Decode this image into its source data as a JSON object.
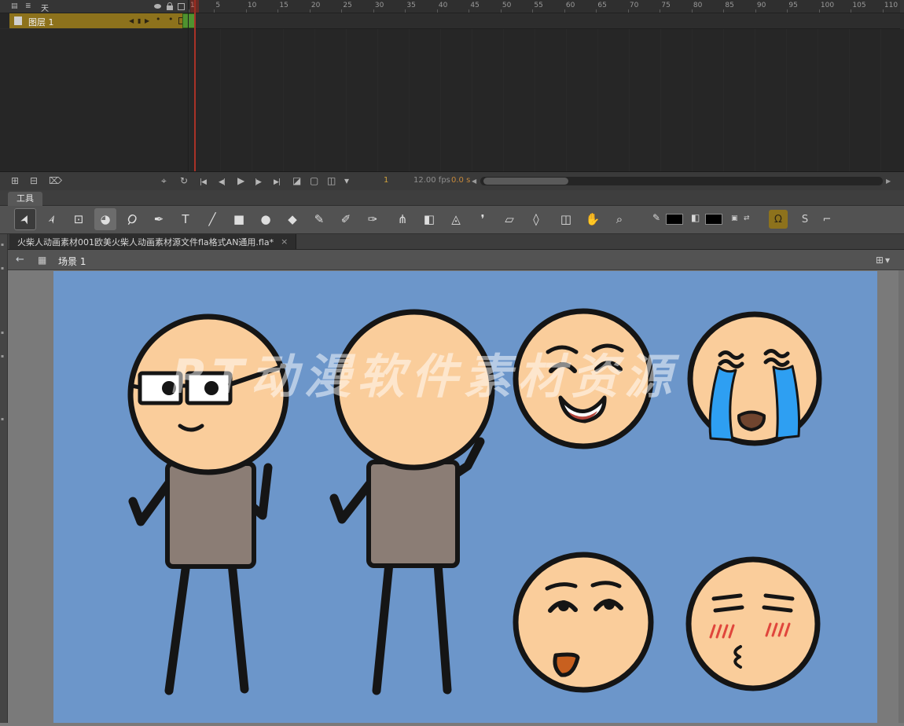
{
  "timeline": {
    "panel_label": "天",
    "header_icon_glyphs": [
      "▤",
      "≣"
    ],
    "layer": {
      "name": "图层 1",
      "nav": [
        "◀",
        "▮",
        "▶"
      ],
      "status_dots": [
        "•",
        "•"
      ]
    },
    "ruler_frames": [
      1,
      5,
      10,
      15,
      20,
      25,
      30,
      35,
      40,
      45,
      50,
      55,
      60,
      65,
      70,
      75,
      80,
      85,
      90,
      95,
      100,
      105,
      110
    ],
    "current_frame": "1",
    "frame_rate": "12.00 fps",
    "elapsed_time": "0.0 s",
    "buttons": {
      "left": [
        {
          "name": "new-layer-button",
          "glyph": "⊞"
        },
        {
          "name": "new-folder-button",
          "glyph": "⊟"
        },
        {
          "name": "delete-layer-button",
          "glyph": "⌦"
        }
      ],
      "middle": [
        {
          "name": "center-frame-button",
          "glyph": "⌖"
        },
        {
          "name": "loop-button",
          "glyph": "↻"
        }
      ],
      "playback": [
        {
          "name": "go-to-first-frame-button",
          "glyph": "|◀",
          "small": true
        },
        {
          "name": "step-back-button",
          "glyph": "◀|",
          "small": true
        },
        {
          "name": "play-button",
          "glyph": "▶"
        },
        {
          "name": "step-forward-button",
          "glyph": "|▶",
          "small": true
        },
        {
          "name": "go-to-last-frame-button",
          "glyph": "▶|",
          "small": true
        }
      ],
      "onion": [
        {
          "name": "onion-skin-button",
          "glyph": "◪"
        },
        {
          "name": "onion-skin-outlines-button",
          "glyph": "▢"
        },
        {
          "name": "edit-multiple-frames-button",
          "glyph": "◫"
        },
        {
          "name": "modify-markers-button",
          "glyph": "▾"
        }
      ],
      "scroll_left_glyph": "◀",
      "scroll_right_glyph": "▶"
    }
  },
  "tools": {
    "tab_label": "工具",
    "items": [
      {
        "name": "selection-tool",
        "glyph": "➤",
        "state": "selected",
        "rotate": -65
      },
      {
        "name": "subselection-tool",
        "glyph": "➢",
        "rotate": -65
      },
      {
        "name": "free-transform-tool",
        "glyph": "⊡"
      },
      {
        "name": "gradient-transform-tool",
        "glyph": "◕",
        "state": "highlighted"
      },
      {
        "name": "lasso-tool",
        "glyph": "Ϙ",
        "rotate": 35
      },
      {
        "name": "pen-tool",
        "glyph": "✒"
      },
      {
        "name": "text-tool",
        "glyph": "T"
      },
      {
        "name": "line-tool",
        "glyph": "╱"
      },
      {
        "name": "rectangle-tool",
        "glyph": "■"
      },
      {
        "name": "oval-tool",
        "glyph": "●"
      },
      {
        "name": "polystar-tool",
        "glyph": "◆"
      },
      {
        "name": "pencil-tool",
        "glyph": "✎"
      },
      {
        "name": "brush-tool",
        "glyph": "✐"
      },
      {
        "name": "paint-brush-tool",
        "glyph": "✑"
      },
      {
        "name": "bone-tool",
        "glyph": "⋔"
      },
      {
        "name": "paint-bucket-tool",
        "glyph": "◧"
      },
      {
        "name": "ink-bottle-tool",
        "glyph": "◬"
      },
      {
        "name": "eyedropper-tool",
        "glyph": "❜"
      },
      {
        "name": "eraser-tool",
        "glyph": "▱"
      },
      {
        "name": "width-tool",
        "glyph": "◊"
      },
      {
        "name": "camera-tool",
        "glyph": "◫"
      },
      {
        "name": "hand-tool",
        "glyph": "✋"
      },
      {
        "name": "zoom-tool",
        "glyph": "⌕"
      }
    ],
    "colors": {
      "stroke_icon": "✎",
      "stroke_color": "#000000",
      "fill_icon": "◧",
      "fill_color": "#000000"
    },
    "small_buttons": [
      {
        "name": "default-colors-button",
        "glyph": "▣"
      },
      {
        "name": "swap-colors-button",
        "glyph": "⇄"
      }
    ],
    "options": [
      {
        "name": "snap-to-objects-toggle",
        "glyph": "Ω",
        "active": true
      },
      {
        "name": "smooth-button",
        "glyph": "S"
      },
      {
        "name": "straighten-button",
        "glyph": "⌐"
      }
    ]
  },
  "document_tab": {
    "title": "火柴人动画素材001欧美火柴人动画素材源文件fla格式AN通用.fla*",
    "close_glyph": "×"
  },
  "edit_bar": {
    "back_glyph": "←",
    "clapper_glyph": "▦",
    "scene_label": "场景 1",
    "edit_symbols_glyph": "⊞",
    "dropdown_glyph": "▾"
  },
  "stage": {
    "watermark": "RT动漫软件素材资源",
    "colors": {
      "background": "#6C96CA",
      "skin": "#FACD9B",
      "shirt": "#8B7D75",
      "outline": "#151515",
      "tears": "#2E9FF2",
      "mouth_orange": "#C8601F",
      "mouth_red": "#B5453C",
      "mouth_dark": "#70452F",
      "blush": "#E0463C",
      "watermark_white": "#FFFFFF"
    }
  }
}
